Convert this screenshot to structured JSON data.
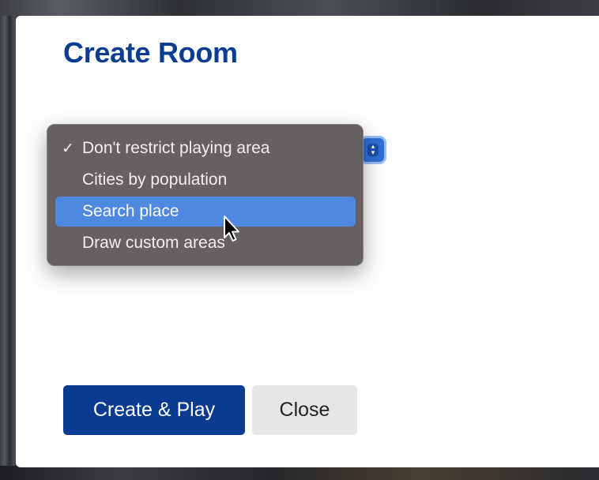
{
  "dialog": {
    "title": "Create Room"
  },
  "area_select": {
    "options": [
      {
        "label": "Don't restrict playing area",
        "checked": true
      },
      {
        "label": "Cities by population",
        "checked": false
      },
      {
        "label": "Search place",
        "checked": false,
        "highlighted": true
      },
      {
        "label": "Draw custom areas",
        "checked": false
      }
    ],
    "check_glyph": "✓"
  },
  "buttons": {
    "create_play": "Create & Play",
    "close": "Close"
  },
  "colors": {
    "title": "#0a3d91",
    "primary_button": "#0b3b91",
    "secondary_button": "#e6e6e6",
    "menu_highlight": "#4f88e0",
    "menu_background": "#605a5a"
  },
  "icons": {
    "select_arrows": "chevron-up-down-icon",
    "pointer": "mouse-pointer-icon"
  }
}
